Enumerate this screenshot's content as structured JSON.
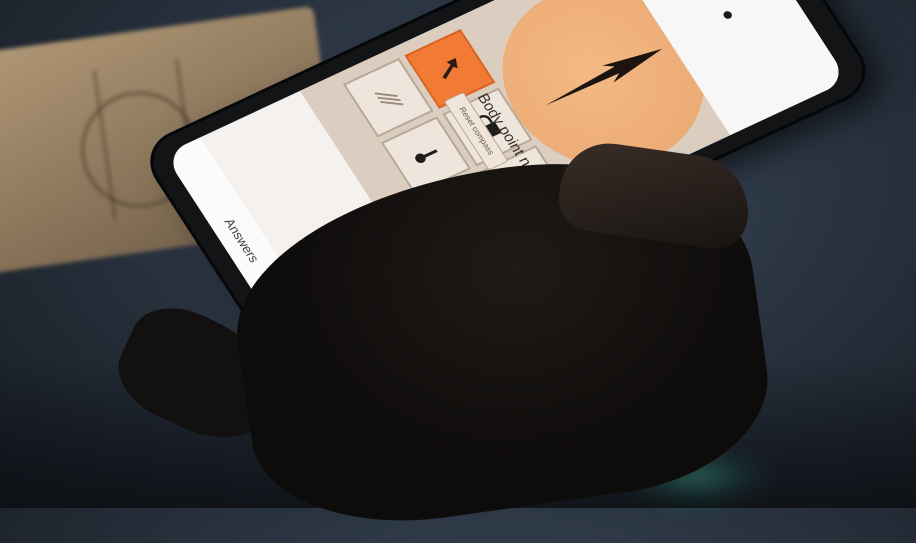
{
  "app": {
    "heading_text": "Body point n",
    "reset_label": "Reset compass",
    "answers_label": "Answers",
    "tiles": [
      {
        "name": "lines",
        "icon": "lines-icon",
        "active": false
      },
      {
        "name": "key",
        "icon": "key-icon",
        "active": false
      },
      {
        "name": "compass",
        "icon": "compass-arrow-icon",
        "active": true
      },
      {
        "name": "lock",
        "icon": "lock-icon",
        "active": false
      }
    ],
    "accent_color": "#f17b34",
    "marker_color": "#f26a2a"
  }
}
